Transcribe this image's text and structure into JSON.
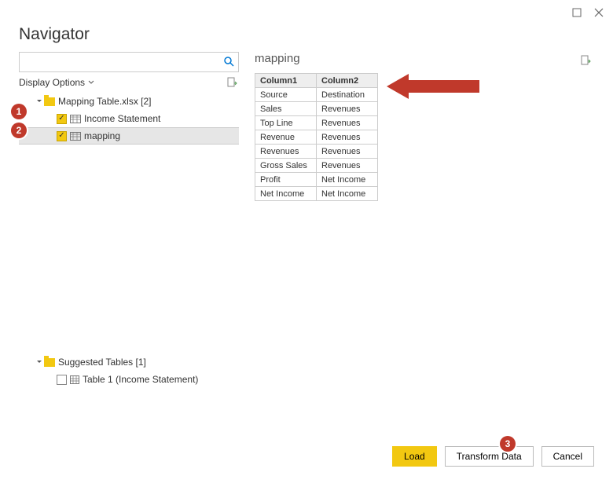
{
  "window": {
    "title": "Navigator"
  },
  "search": {
    "placeholder": ""
  },
  "options": {
    "label": "Display Options"
  },
  "tree": {
    "file": "Mapping Table.xlsx [2]",
    "items": [
      {
        "label": "Income Statement"
      },
      {
        "label": "mapping"
      }
    ],
    "suggested_header": "Suggested Tables [1]",
    "suggested_item": "Table 1 (Income Statement)"
  },
  "preview": {
    "title": "mapping",
    "headers": [
      "Column1",
      "Column2"
    ],
    "rows": [
      [
        "Source",
        "Destination"
      ],
      [
        "Sales",
        "Revenues"
      ],
      [
        "Top Line",
        "Revenues"
      ],
      [
        "Revenue",
        "Revenues"
      ],
      [
        "Revenues",
        "Revenues"
      ],
      [
        "Gross Sales",
        "Revenues"
      ],
      [
        "Profit",
        "Net Income"
      ],
      [
        "Net Income",
        "Net Income"
      ]
    ]
  },
  "buttons": {
    "load": "Load",
    "transform": "Transform Data",
    "cancel": "Cancel"
  },
  "callouts": [
    "1",
    "2",
    "3"
  ]
}
